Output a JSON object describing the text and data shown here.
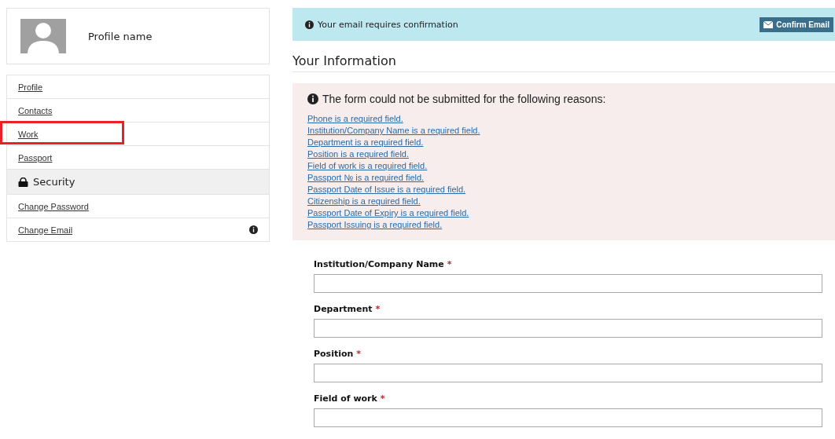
{
  "profile": {
    "name": "Profile name"
  },
  "nav": [
    {
      "label": "Profile",
      "highlighted": false
    },
    {
      "label": "Contacts",
      "highlighted": false
    },
    {
      "label": "Work",
      "highlighted": true
    },
    {
      "label": "Passport",
      "highlighted": false
    }
  ],
  "security": {
    "title": "Security",
    "items": [
      {
        "label": "Change Password",
        "warning": false
      },
      {
        "label": "Change Email",
        "warning": true
      }
    ]
  },
  "alert": {
    "text": "Your email requires confirmation",
    "button": "Confirm Email"
  },
  "heading": "Your Information",
  "errors": {
    "title": "The form could not be submitted for the following reasons:",
    "items": [
      "Phone is a required field.",
      "Institution/Company Name is a required field.",
      "Department is a required field.",
      "Position is a required field.",
      "Field of work is a required field.",
      "Passport № is a required field.",
      "Passport Date of Issue is a required field.",
      "Citizenship is a required field.",
      "Passport Date of Expiry is a required field.",
      "Passport Issuing is a required field."
    ]
  },
  "fields": [
    {
      "label": "Institution/Company Name",
      "mark": "*"
    },
    {
      "label": "Department",
      "mark": "*"
    },
    {
      "label": "Position",
      "mark": "*"
    },
    {
      "label": "Field of work",
      "mark": "*"
    }
  ]
}
